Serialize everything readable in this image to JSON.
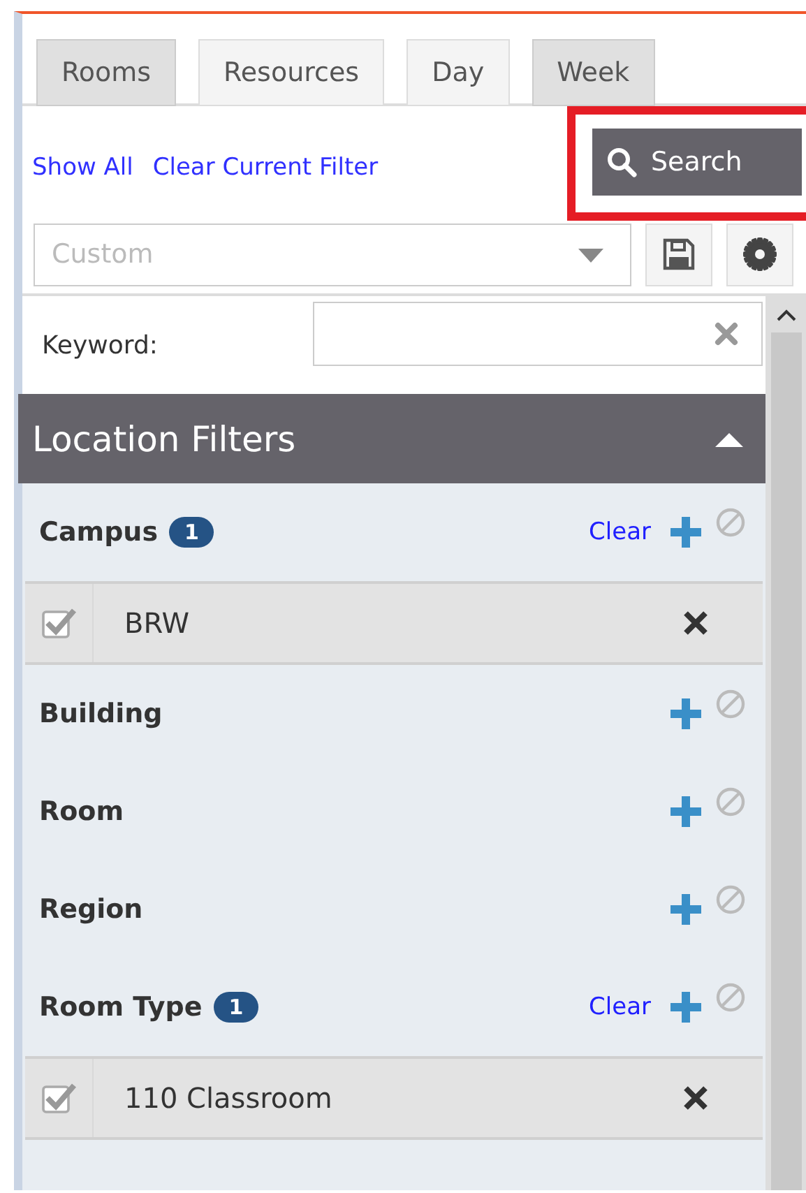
{
  "view_tabs": [
    {
      "label": "Rooms",
      "selected": true
    },
    {
      "label": "Resources",
      "selected": false
    },
    {
      "label": "Day",
      "selected": false
    },
    {
      "label": "Week",
      "selected": true
    }
  ],
  "filter_links": [
    "Show All",
    "Clear Current Filter"
  ],
  "search_button": {
    "label": "Search",
    "highlighted": true
  },
  "saved_filter": {
    "placeholder": "Custom"
  },
  "keyword": {
    "label": "Keyword:"
  },
  "location_filters": {
    "title": "Location Filters",
    "expanded": true,
    "groups": [
      {
        "label": "Campus",
        "count": "1",
        "clear": "Clear",
        "items": [
          {
            "label": "BRW",
            "checked": true
          }
        ]
      },
      {
        "label": "Building"
      },
      {
        "label": "Room"
      },
      {
        "label": "Region"
      },
      {
        "label": "Room Type",
        "count": "1",
        "clear": "Clear",
        "items": [
          {
            "label": "110 Classroom",
            "checked": true
          }
        ]
      }
    ]
  }
}
